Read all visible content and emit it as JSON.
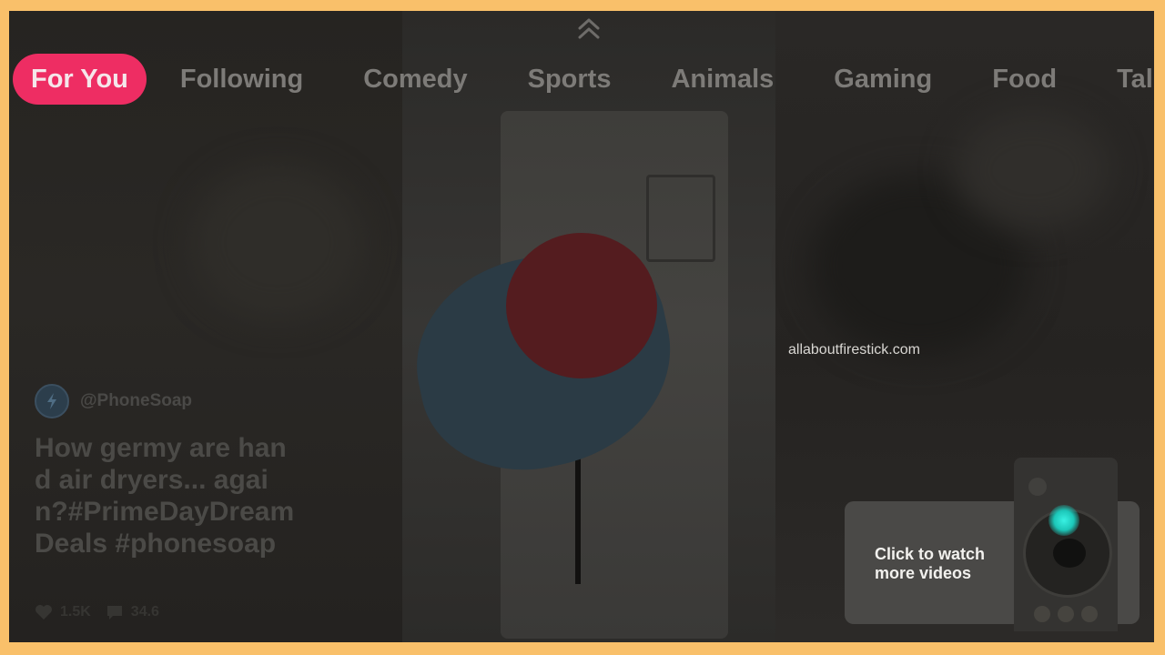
{
  "tabs": {
    "items": [
      {
        "label": "For You",
        "active": true
      },
      {
        "label": "Following",
        "active": false
      },
      {
        "label": "Comedy",
        "active": false
      },
      {
        "label": "Sports",
        "active": false
      },
      {
        "label": "Animals",
        "active": false
      },
      {
        "label": "Gaming",
        "active": false
      },
      {
        "label": "Food",
        "active": false
      },
      {
        "label": "Talen",
        "active": false
      }
    ]
  },
  "video": {
    "author_handle": "@PhoneSoap",
    "caption": "How germy are hand air dryers... again?#PrimeDayDreamDeals #phonesoap",
    "likes": "1.5K",
    "comments": "34.6"
  },
  "watermark": "allaboutfirestick.com",
  "hint": {
    "text": "Click to watch more videos"
  },
  "colors": {
    "accent": "#ee2d63",
    "frame": "#f9c06a",
    "remote_glow": "#39f1e3"
  },
  "icons": {
    "chevron": "double-chevron-up-icon",
    "avatar": "lightning-icon",
    "like": "heart-icon",
    "comment": "comment-icon"
  }
}
